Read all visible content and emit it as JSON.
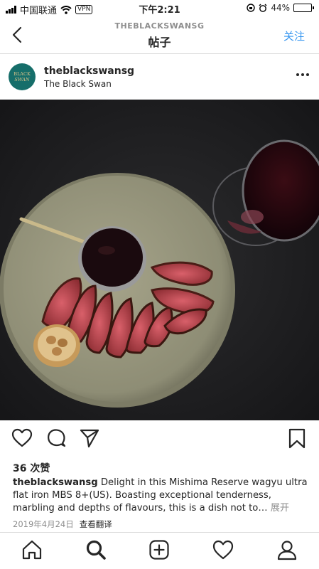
{
  "status_bar": {
    "carrier": "中国联通",
    "vpn": "VPN",
    "time": "下午2:21",
    "battery_percent": "44%",
    "battery_level": 0.44
  },
  "nav": {
    "subtitle": "THEBLACKSWANSG",
    "title": "帖子",
    "follow_label": "关注"
  },
  "post": {
    "username": "theblackswansg",
    "location": "The Black Swan",
    "likes": "36 次赞",
    "caption_user": "theblackswansg",
    "caption_text": " Delight in this Mishima Reserve wagyu ultra flat iron MBS 8+(US). Boasting exceptional tenderness, marbling and depths of flavours, this is a dish not to…",
    "caption_more": " 展开",
    "date": "2019年4月24日",
    "translate_label": "查看翻译"
  },
  "colors": {
    "accent": "#3897f0",
    "text": "#262626",
    "muted": "#8e8e8e",
    "avatar_bg": "#166e6a"
  },
  "icons": [
    "back-icon",
    "more-icon",
    "heart-icon",
    "comment-icon",
    "share-icon",
    "bookmark-icon",
    "home-icon",
    "search-icon",
    "add-icon",
    "activity-icon",
    "profile-icon"
  ]
}
